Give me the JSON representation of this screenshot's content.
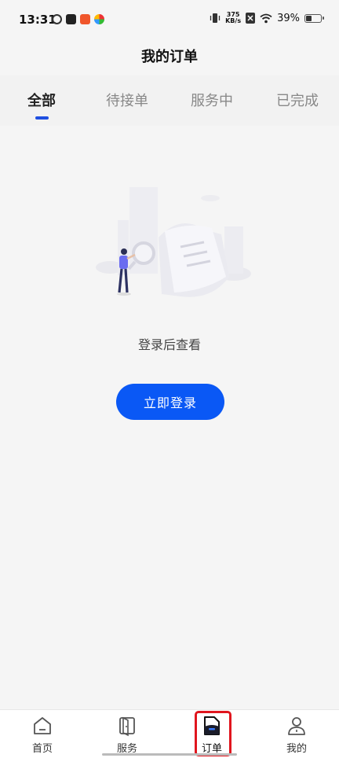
{
  "status_bar": {
    "time": "13:31",
    "net_speed_value": "375",
    "net_speed_unit": "KB/s",
    "battery_text": "39%",
    "battery_level": 0.39
  },
  "header": {
    "title": "我的订单"
  },
  "tabs": [
    {
      "label": "全部",
      "active": true
    },
    {
      "label": "待接单",
      "active": false
    },
    {
      "label": "服务中",
      "active": false
    },
    {
      "label": "已完成",
      "active": false
    }
  ],
  "empty_state": {
    "message": "登录后查看",
    "button_label": "立即登录"
  },
  "bottom_nav": [
    {
      "label": "首页",
      "icon": "home-icon"
    },
    {
      "label": "服务",
      "icon": "service-door-icon"
    },
    {
      "label": "订单",
      "icon": "order-document-icon",
      "active": true
    },
    {
      "label": "我的",
      "icon": "profile-icon"
    }
  ],
  "colors": {
    "accent": "#0a58f5",
    "tab_indicator": "#1f4fe0",
    "highlight": "#e0161e",
    "background": "#f5f5f5"
  }
}
